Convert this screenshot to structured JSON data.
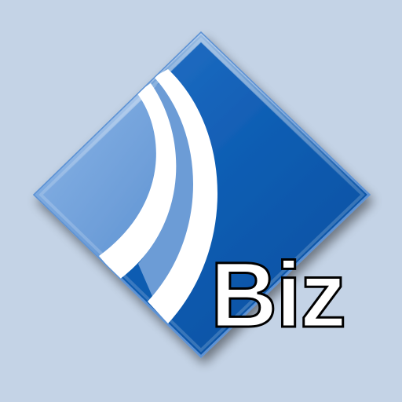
{
  "icon": {
    "name": "biz-app-icon",
    "text": "Biz",
    "colors": {
      "background": "#c4d3e6",
      "diamond_dark": "#0d5ab0",
      "diamond_light": "#6f9fd8",
      "stripe": "#ffffff",
      "text_fill": "#ffffff",
      "text_stroke": "#000000"
    }
  }
}
